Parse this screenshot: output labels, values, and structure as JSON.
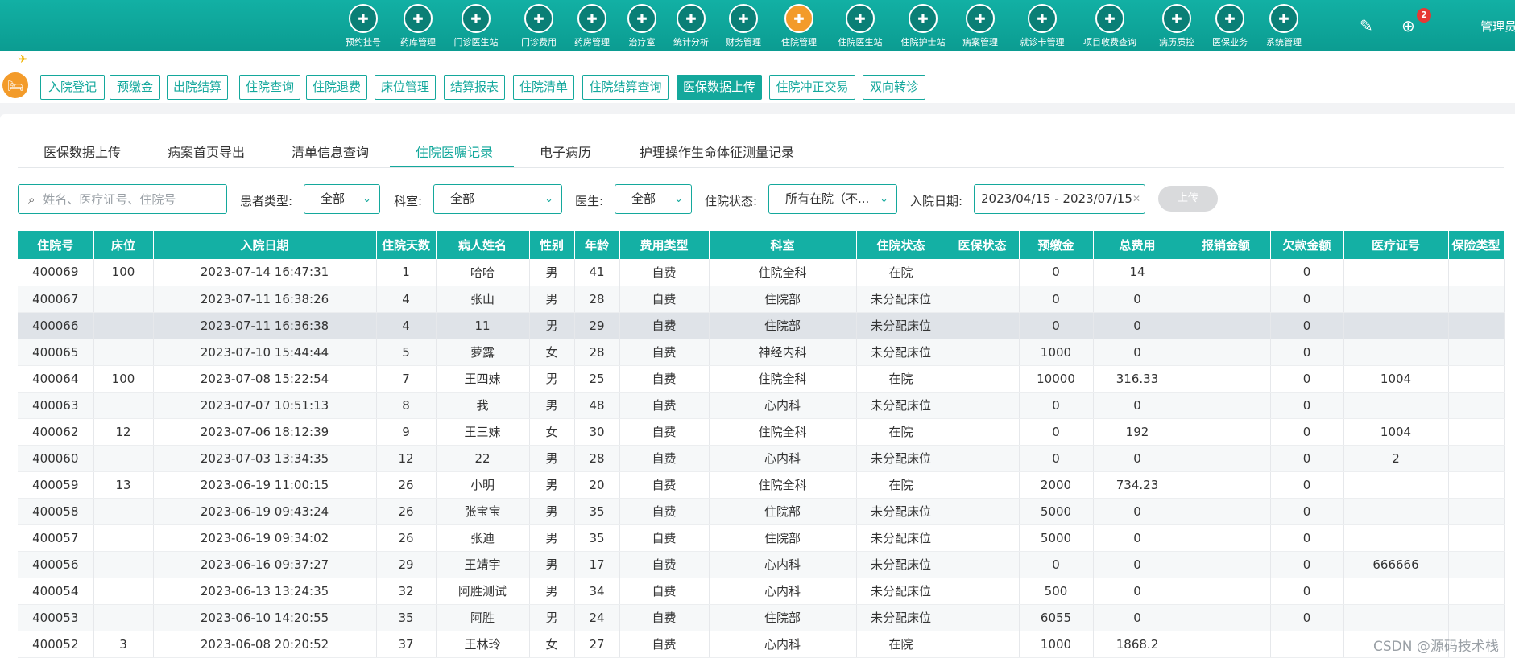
{
  "nav": {
    "items": [
      {
        "label": "预约挂号",
        "icon": "calendar-icon"
      },
      {
        "label": "药库管理",
        "icon": "warehouse-icon"
      },
      {
        "label": "门诊医生站",
        "icon": "doctor-icon"
      },
      {
        "label": "门诊费用",
        "icon": "yuan-icon"
      },
      {
        "label": "药房管理",
        "icon": "pill-icon"
      },
      {
        "label": "治疗室",
        "icon": "nurse-icon"
      },
      {
        "label": "统计分析",
        "icon": "chart-icon"
      },
      {
        "label": "财务管理",
        "icon": "gear-money-icon"
      },
      {
        "label": "住院管理",
        "icon": "bed-icon"
      },
      {
        "label": "住院医生站",
        "icon": "inpatient-doctor-icon"
      },
      {
        "label": "住院护士站",
        "icon": "inpatient-nurse-icon"
      },
      {
        "label": "病案管理",
        "icon": "record-icon"
      },
      {
        "label": "就诊卡管理",
        "icon": "card-icon"
      },
      {
        "label": "项目收费查询",
        "icon": "fee-query-icon"
      },
      {
        "label": "病历质控",
        "icon": "quality-icon"
      },
      {
        "label": "医保业务",
        "icon": "insurance-icon"
      },
      {
        "label": "系统管理",
        "icon": "settings-icon"
      }
    ],
    "badge_count": "2",
    "admin_label": "管理员"
  },
  "functions": [
    "入院登记",
    "预缴金",
    "出院结算",
    "住院查询",
    "住院退费",
    "床位管理",
    "结算报表",
    "住院清单",
    "住院结算查询",
    "医保数据上传",
    "住院冲正交易",
    "双向转诊"
  ],
  "tabs": [
    "医保数据上传",
    "病案首页导出",
    "清单信息查询",
    "住院医嘱记录",
    "电子病历",
    "护理操作生命体征测量记录"
  ],
  "filters": {
    "search_placeholder": "姓名、医疗证号、住院号",
    "patient_type_label": "患者类型:",
    "patient_type_value": "全部",
    "dept_label": "科室:",
    "dept_value": "全部",
    "doctor_label": "医生:",
    "doctor_value": "全部",
    "status_label": "住院状态:",
    "status_value": "所有在院（不...",
    "date_label": "入院日期:",
    "date_value": "2023/04/15 - 2023/07/15",
    "upload_label": "上传"
  },
  "table": {
    "headers": [
      "住院号",
      "床位",
      "入院日期",
      "住院天数",
      "病人姓名",
      "性别",
      "年龄",
      "费用类型",
      "科室",
      "住院状态",
      "医保状态",
      "预缴金",
      "总费用",
      "报销金额",
      "欠款金额",
      "医疗证号",
      "保险类型"
    ],
    "rows": [
      [
        "400069",
        "100",
        "2023-07-14 16:47:31",
        "1",
        "哈哈",
        "男",
        "41",
        "自费",
        "住院全科",
        "在院",
        "",
        "0",
        "14",
        "",
        "0",
        "",
        ""
      ],
      [
        "400067",
        "",
        "2023-07-11 16:38:26",
        "4",
        "张山",
        "男",
        "28",
        "自费",
        "住院部",
        "未分配床位",
        "",
        "0",
        "0",
        "",
        "0",
        "",
        ""
      ],
      [
        "400066",
        "",
        "2023-07-11 16:36:38",
        "4",
        "11",
        "男",
        "29",
        "自费",
        "住院部",
        "未分配床位",
        "",
        "0",
        "0",
        "",
        "0",
        "",
        ""
      ],
      [
        "400065",
        "",
        "2023-07-10 15:44:44",
        "5",
        "萝露",
        "女",
        "28",
        "自费",
        "神经内科",
        "未分配床位",
        "",
        "1000",
        "0",
        "",
        "0",
        "",
        ""
      ],
      [
        "400064",
        "100",
        "2023-07-08 15:22:54",
        "7",
        "王四妹",
        "男",
        "25",
        "自费",
        "住院全科",
        "在院",
        "",
        "10000",
        "316.33",
        "",
        "0",
        "1004",
        ""
      ],
      [
        "400063",
        "",
        "2023-07-07 10:51:13",
        "8",
        "我",
        "男",
        "48",
        "自费",
        "心内科",
        "未分配床位",
        "",
        "0",
        "0",
        "",
        "0",
        "",
        ""
      ],
      [
        "400062",
        "12",
        "2023-07-06 18:12:39",
        "9",
        "王三妹",
        "女",
        "30",
        "自费",
        "住院全科",
        "在院",
        "",
        "0",
        "192",
        "",
        "0",
        "1004",
        ""
      ],
      [
        "400060",
        "",
        "2023-07-03 13:34:35",
        "12",
        "22",
        "男",
        "28",
        "自费",
        "心内科",
        "未分配床位",
        "",
        "0",
        "0",
        "",
        "0",
        "2",
        ""
      ],
      [
        "400059",
        "13",
        "2023-06-19 11:00:15",
        "26",
        "小明",
        "男",
        "20",
        "自费",
        "住院全科",
        "在院",
        "",
        "2000",
        "734.23",
        "",
        "0",
        "",
        ""
      ],
      [
        "400058",
        "",
        "2023-06-19 09:43:24",
        "26",
        "张宝宝",
        "男",
        "35",
        "自费",
        "住院部",
        "未分配床位",
        "",
        "5000",
        "0",
        "",
        "0",
        "",
        ""
      ],
      [
        "400057",
        "",
        "2023-06-19 09:34:02",
        "26",
        "张迪",
        "男",
        "35",
        "自费",
        "住院部",
        "未分配床位",
        "",
        "5000",
        "0",
        "",
        "0",
        "",
        ""
      ],
      [
        "400056",
        "",
        "2023-06-16 09:37:27",
        "29",
        "王靖宇",
        "男",
        "17",
        "自费",
        "心内科",
        "未分配床位",
        "",
        "0",
        "0",
        "",
        "0",
        "666666",
        ""
      ],
      [
        "400054",
        "",
        "2023-06-13 13:24:35",
        "32",
        "阿胜测试",
        "男",
        "34",
        "自费",
        "心内科",
        "未分配床位",
        "",
        "500",
        "0",
        "",
        "0",
        "",
        ""
      ],
      [
        "400053",
        "",
        "2023-06-10 14:20:55",
        "35",
        "阿胜",
        "男",
        "24",
        "自费",
        "住院部",
        "未分配床位",
        "",
        "6055",
        "0",
        "",
        "0",
        "",
        ""
      ],
      [
        "400052",
        "3",
        "2023-06-08 20:20:52",
        "37",
        "王林玲",
        "女",
        "27",
        "自费",
        "心内科",
        "在院",
        "",
        "1000",
        "1868.2",
        "",
        "",
        "",
        ""
      ]
    ]
  },
  "watermark": "CSDN @源码技术栈",
  "colors": {
    "primary": "#14a89c",
    "header": "#14b0a4",
    "in_hospital": "#1ea645",
    "no_bed": "#e02c2c",
    "active_module": "#f39b2a"
  }
}
